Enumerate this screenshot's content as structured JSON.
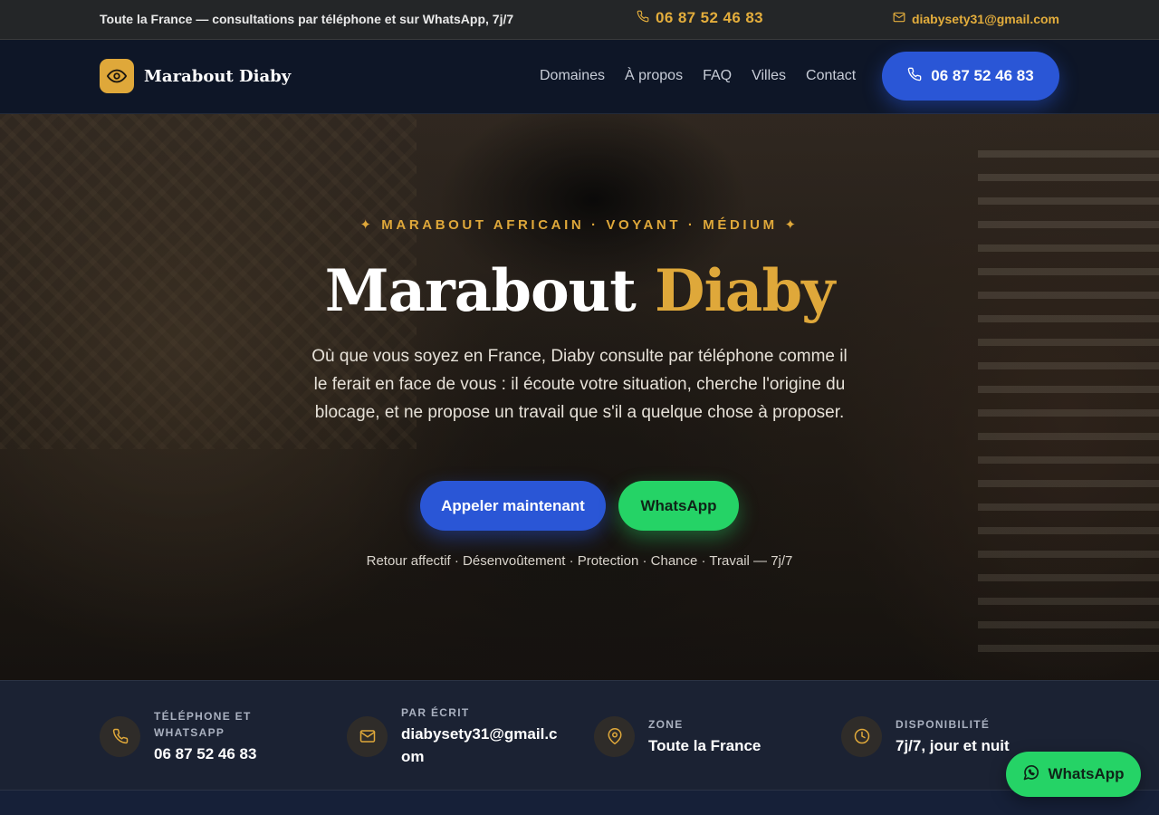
{
  "topbar": {
    "tagline": "Toute la France — consultations par téléphone et sur WhatsApp, 7j/7",
    "phone": "06 87 52 46 83",
    "email": "diabysety31@gmail.com"
  },
  "nav": {
    "brand": "Marabout Diaby",
    "links": [
      "Domaines",
      "À propos",
      "FAQ",
      "Villes",
      "Contact"
    ],
    "cta_phone": "06 87 52 46 83"
  },
  "hero": {
    "eyebrow": "✦ MARABOUT AFRICAIN · VOYANT · MÉDIUM ✦",
    "title_a": "Marabout",
    "title_b": "Diaby",
    "lead": "Où que vous soyez en France, Diaby consulte par téléphone comme il le ferait en face de vous : il écoute votre situation, cherche l'origine du blocage, et ne propose un travail que s'il a quelque chose à proposer.",
    "btn_call": "Appeler maintenant",
    "btn_whatsapp": "WhatsApp",
    "services": "Retour affectif · Désenvoûtement · Protection · Chance · Travail — 7j/7"
  },
  "info": [
    {
      "icon": "phone-icon",
      "label": "TÉLÉPHONE ET WHATSAPP",
      "value": "06 87 52 46 83"
    },
    {
      "icon": "mail-icon",
      "label": "PAR ÉCRIT",
      "value": "diabysety31@gmail.com"
    },
    {
      "icon": "location-pin-icon",
      "label": "ZONE",
      "value": "Toute la France"
    },
    {
      "icon": "clock-icon",
      "label": "DISPONIBILITÉ",
      "value": "7j/7, jour et nuit"
    }
  ],
  "floating_whatsapp": "WhatsApp",
  "colors": {
    "gold": "#dfa83a",
    "blue": "#2a56d6",
    "green": "#25d366",
    "navy": "#0e1627"
  }
}
